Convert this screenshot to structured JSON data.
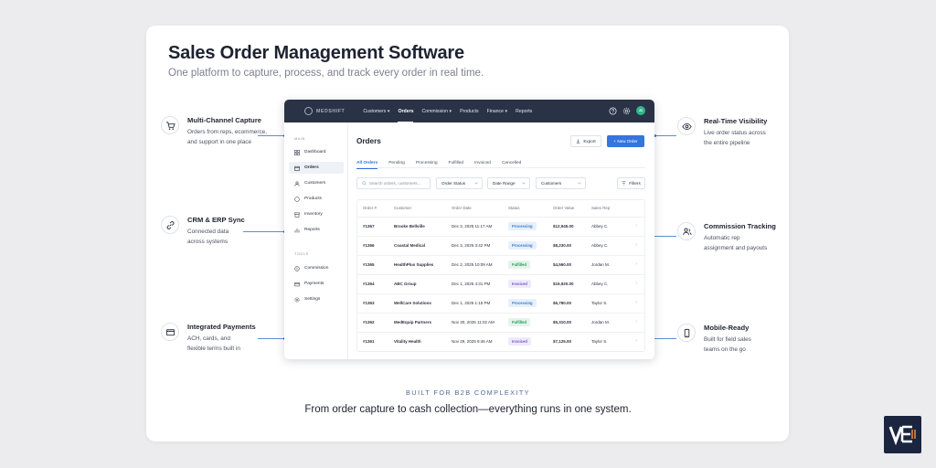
{
  "header": {
    "title": "Sales Order Management Software",
    "subtitle": "One platform to capture, process, and track every order in real time."
  },
  "features_left": [
    {
      "title": "Multi-Channel Capture",
      "desc": "Orders from reps, ecommerce,\nand support in one place",
      "icon": "cart-icon"
    },
    {
      "title": "CRM & ERP Sync",
      "desc": "Connected data\nacross systems",
      "icon": "link-icon"
    },
    {
      "title": "Integrated Payments",
      "desc": "ACH, cards, and\nflexible terms built in",
      "icon": "card-icon"
    }
  ],
  "features_right": [
    {
      "title": "Real-Time Visibility",
      "desc": "Live order status across\nthe entire pipeline",
      "icon": "eye-icon"
    },
    {
      "title": "Commission Tracking",
      "desc": "Automatic rep\nassignment and payouts",
      "icon": "users-icon"
    },
    {
      "title": "Mobile-Ready",
      "desc": "Built for field sales\nteams on the go",
      "icon": "phone-icon"
    }
  ],
  "app": {
    "logo": "MEDSHIFT",
    "nav": [
      "Customers",
      "Orders",
      "Commission",
      "Products",
      "Finance",
      "Reports"
    ],
    "nav_dropdown": [
      "▾",
      "",
      "▾",
      "",
      "▾",
      ""
    ],
    "avatar": "JC",
    "sidebar": {
      "section_main": "MAIN",
      "main_items": [
        "Dashboard",
        "Orders",
        "Customers",
        "Products",
        "Inventory",
        "Reports"
      ],
      "section_tools": "TOOLS",
      "tool_items": [
        "Commission",
        "Payments",
        "Settings"
      ]
    },
    "page_title": "Orders",
    "export_label": "Export",
    "new_order_label": "+ New Order",
    "tabs": [
      "All Orders",
      "Pending",
      "Processing",
      "Fulfilled",
      "Invoiced",
      "Cancelled"
    ],
    "search_placeholder": "Search orders, customers...",
    "filter_selects": [
      "Order Status",
      "Date Range",
      "Customers"
    ],
    "filters_label": "Filters",
    "columns": [
      "Order #",
      "Customer",
      "Order Date",
      "Status",
      "Order Value",
      "Sales Rep"
    ],
    "rows": [
      {
        "id": "#1367",
        "customer": "Brooke Bellville",
        "date": "Dec 3, 2025 11:17 AM",
        "status": "Processing",
        "value": "$12,945.00",
        "rep": "Abbey C."
      },
      {
        "id": "#1366",
        "customer": "Coastal Medical",
        "date": "Dec 3, 2025 3:42 PM",
        "status": "Processing",
        "value": "$8,230.00",
        "rep": "Abbey C."
      },
      {
        "id": "#1365",
        "customer": "HealthPlus Supplies",
        "date": "Dec 2, 2025 10:09 AM",
        "status": "Fulfilled",
        "value": "$4,560.00",
        "rep": "Jordan M."
      },
      {
        "id": "#1364",
        "customer": "ABC Group",
        "date": "Dec 1, 2025 4:31 PM",
        "status": "Invoiced",
        "value": "$15,920.00",
        "rep": "Abbey C."
      },
      {
        "id": "#1363",
        "customer": "WellCare Solutions",
        "date": "Dec 1, 2025 1:15 PM",
        "status": "Processing",
        "value": "$6,780.00",
        "rep": "Taylor S."
      },
      {
        "id": "#1362",
        "customer": "MedEquip Partners",
        "date": "Nov 30, 2025 11:02 AM",
        "status": "Fulfilled",
        "value": "$5,310.00",
        "rep": "Jordan M."
      },
      {
        "id": "#1361",
        "customer": "Vitality Health",
        "date": "Nov 29, 2025 9:46 AM",
        "status": "Invoiced",
        "value": "$7,125.00",
        "rep": "Taylor S."
      }
    ],
    "status_colors": {
      "Processing": {
        "bg": "#e6f0fb",
        "fg": "#3f7fc8"
      },
      "Fulfilled": {
        "bg": "#e4f4ea",
        "fg": "#2f9a5e"
      },
      "Invoiced": {
        "bg": "#efeafa",
        "fg": "#7a5cc5"
      }
    }
  },
  "footer": {
    "kicker": "BUILT FOR B2B COMPLEXITY",
    "tagline": "From order capture to cash collection—everything runs in one system."
  },
  "colors": {
    "accent": "#3475e0",
    "topbar": "#2a3245",
    "brand": "#1b2540"
  }
}
